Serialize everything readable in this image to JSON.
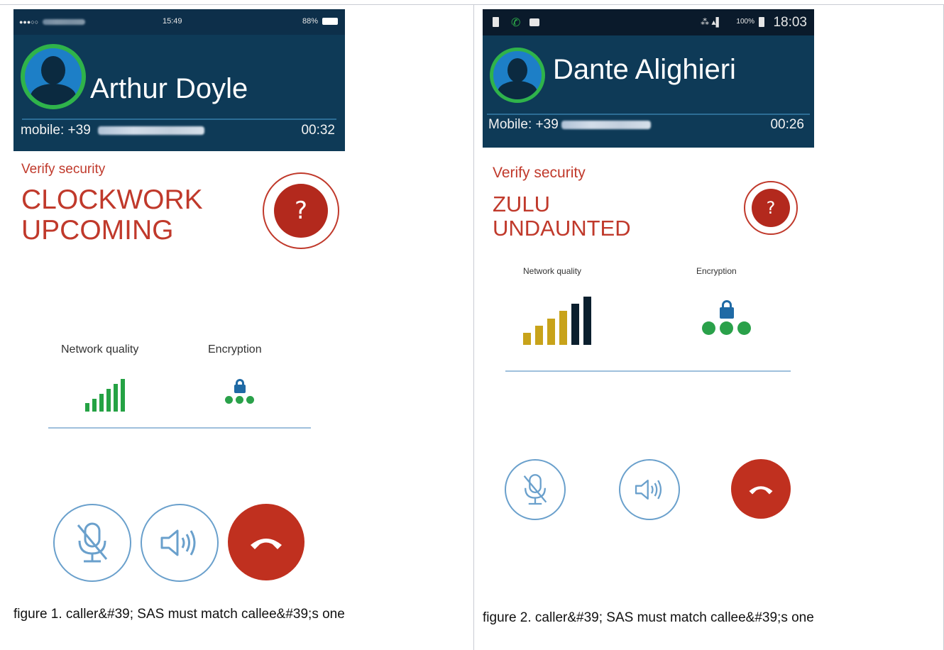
{
  "panels": [
    {
      "status_bar": {
        "carrier": "●●●○○",
        "time": "15:49",
        "battery": "88%"
      },
      "caller": {
        "name": "Arthur Doyle",
        "number_label": "mobile: +39",
        "duration": "00:32"
      },
      "security": {
        "label": "Verify security",
        "sas_words": [
          "CLOCKWORK",
          "UPCOMING"
        ],
        "verify_button_label": "?"
      },
      "metrics": {
        "network_label": "Network quality",
        "encryption_label": "Encryption",
        "network_level": 6,
        "network_bars": 6,
        "encryption_dots": 3
      },
      "colors": {
        "bars": [
          "#25a244",
          "#25a244",
          "#25a244",
          "#25a244",
          "#25a244",
          "#25a244"
        ]
      },
      "caption": "figure 1. caller&#39; SAS must match callee&#39;s one"
    },
    {
      "status_bar": {
        "time": "18:03",
        "battery": "100%"
      },
      "caller": {
        "name": "Dante Alighieri",
        "number_label": "Mobile: +39",
        "duration": "00:26"
      },
      "security": {
        "label": "Verify security",
        "sas_words": [
          "ZULU",
          "UNDAUNTED"
        ],
        "verify_button_label": "?"
      },
      "metrics": {
        "network_label": "Network quality",
        "encryption_label": "Encryption",
        "network_level": 6,
        "network_bars": 6,
        "encryption_dots": 3
      },
      "colors": {
        "bars": [
          "#c8a31a",
          "#c8a31a",
          "#c8a31a",
          "#c8a31a",
          "#0b1f2e",
          "#0b1f2e"
        ]
      },
      "caption": "figure 2. caller&#39; SAS must match callee&#39;s one"
    }
  ],
  "icons": {
    "mute": "mic-off-icon",
    "speaker": "speaker-icon",
    "hangup": "phone-hangup-icon",
    "avatar": "person-icon",
    "lock": "lock-icon"
  },
  "theme": {
    "header": "#0e3a57",
    "accent_red": "#c0392b",
    "ring_green": "#2fb34a",
    "line_blue": "#9fc0dc"
  }
}
